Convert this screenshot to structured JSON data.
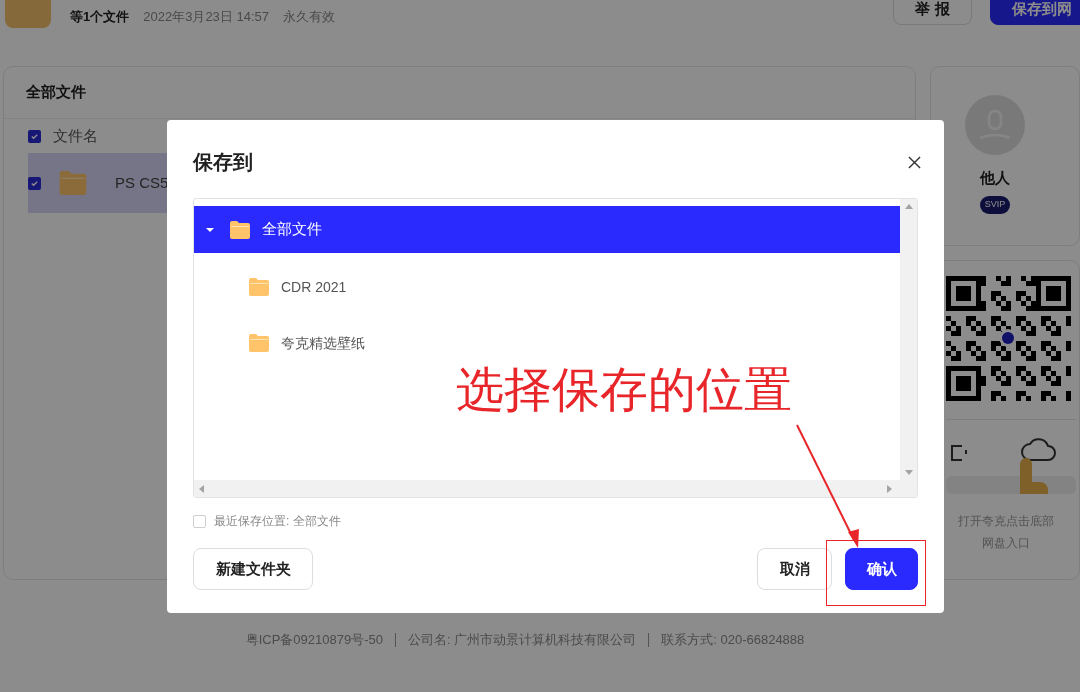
{
  "header": {
    "meta": {
      "count": "等1个文件",
      "date": "2022年3月23日 14:57",
      "validity": "永久有效"
    },
    "buttons": [
      {
        "label": "举 报",
        "kind": "outline"
      },
      {
        "label": "保存到网",
        "kind": "primary"
      }
    ]
  },
  "files": {
    "title": "全部文件",
    "header": {
      "label": "文件名",
      "checked": true
    },
    "rows": [
      {
        "name": "PS CS5",
        "checked": true,
        "selected": true
      }
    ]
  },
  "profile": {
    "name": "他人",
    "badge": "SVIP"
  },
  "promo": {
    "caption": [
      "打开夸克点击底部",
      "网盘入口"
    ]
  },
  "footer": [
    "粤ICP备09210879号-50",
    "公司名: 广州市动景计算机科技有限公司",
    "联系方式: 020-66824888"
  ],
  "dialog": {
    "title": "保存到",
    "tree": [
      {
        "name": "全部文件",
        "selected": true,
        "expanded": true,
        "children": [
          {
            "name": "CDR 2021",
            "selected": false
          },
          {
            "name": "夸克精选壁纸",
            "selected": false
          }
        ]
      }
    ],
    "remember": {
      "label": "最近保存位置: 全部文件",
      "checked": false
    },
    "buttons": [
      {
        "label": "新建文件夹",
        "kind": "outline"
      },
      {
        "label": "取消",
        "kind": "outline"
      },
      {
        "label": "确认",
        "kind": "primary"
      }
    ]
  },
  "annotation": {
    "text": "选择保存的位置"
  }
}
